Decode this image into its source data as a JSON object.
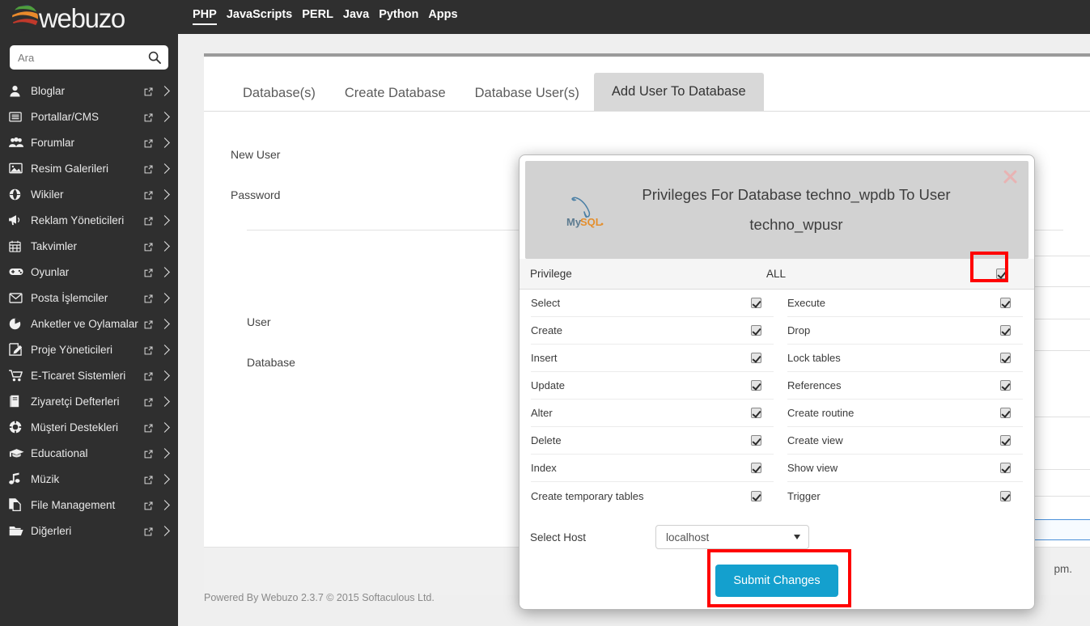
{
  "brand": {
    "name": "webuzo"
  },
  "topnav": {
    "items": [
      {
        "label": "PHP",
        "active": true
      },
      {
        "label": "JavaScripts",
        "active": false
      },
      {
        "label": "PERL",
        "active": false
      },
      {
        "label": "Java",
        "active": false
      },
      {
        "label": "Python",
        "active": false
      },
      {
        "label": "Apps",
        "active": false
      }
    ]
  },
  "search": {
    "placeholder": "Ara",
    "value": ""
  },
  "sidebar": {
    "items": [
      {
        "label": "Bloglar",
        "icon": "user-icon"
      },
      {
        "label": "Portallar/CMS",
        "icon": "list-icon"
      },
      {
        "label": "Forumlar",
        "icon": "users-icon"
      },
      {
        "label": "Resim Galerileri",
        "icon": "image-icon"
      },
      {
        "label": "Wikiler",
        "icon": "globe-icon"
      },
      {
        "label": "Reklam Yöneticileri",
        "icon": "megaphone-icon"
      },
      {
        "label": "Takvimler",
        "icon": "calendar-icon"
      },
      {
        "label": "Oyunlar",
        "icon": "gamepad-icon"
      },
      {
        "label": "Posta İşlemciler",
        "icon": "envelope-icon"
      },
      {
        "label": "Anketler ve Oylamalar",
        "icon": "pie-chart-icon"
      },
      {
        "label": "Proje Yöneticileri",
        "icon": "edit-icon"
      },
      {
        "label": "E-Ticaret Sistemleri",
        "icon": "cart-icon"
      },
      {
        "label": "Ziyaretçi Defterleri",
        "icon": "book-icon"
      },
      {
        "label": "Müşteri Destekleri",
        "icon": "lifebuoy-icon"
      },
      {
        "label": "Educational",
        "icon": "graduation-cap-icon"
      },
      {
        "label": "Müzik",
        "icon": "music-note-icon"
      },
      {
        "label": "File Management",
        "icon": "files-icon"
      },
      {
        "label": "Diğerleri",
        "icon": "folder-open-icon"
      }
    ]
  },
  "tabs": [
    {
      "label": "Database(s)",
      "active": false
    },
    {
      "label": "Create Database",
      "active": false
    },
    {
      "label": "Database User(s)",
      "active": false
    },
    {
      "label": "Add User To Database",
      "active": true
    }
  ],
  "form": {
    "labels": [
      "New User",
      "Password",
      "User",
      "Database"
    ]
  },
  "modal": {
    "title": "Privileges For Database techno_wpdb To User techno_wpusr",
    "logo_alt": "MySQL",
    "close_label": "×",
    "header": {
      "privilege_col": "Privilege",
      "all_col": "ALL",
      "all_checked": true
    },
    "privileges_left": [
      {
        "name": "Select",
        "checked": true
      },
      {
        "name": "Create",
        "checked": true
      },
      {
        "name": "Insert",
        "checked": true
      },
      {
        "name": "Update",
        "checked": true
      },
      {
        "name": "Alter",
        "checked": true
      },
      {
        "name": "Delete",
        "checked": true
      },
      {
        "name": "Index",
        "checked": true
      },
      {
        "name": "Create temporary tables",
        "checked": true
      }
    ],
    "privileges_right": [
      {
        "name": "Execute",
        "checked": true
      },
      {
        "name": "Drop",
        "checked": true
      },
      {
        "name": "Lock tables",
        "checked": true
      },
      {
        "name": "References",
        "checked": true
      },
      {
        "name": "Create routine",
        "checked": true
      },
      {
        "name": "Create view",
        "checked": true
      },
      {
        "name": "Show view",
        "checked": true
      },
      {
        "name": "Trigger",
        "checked": true
      }
    ],
    "host": {
      "label": "Select Host",
      "selected": "localhost",
      "options": [
        "localhost"
      ]
    },
    "submit_label": "Submit Changes"
  },
  "panel_footer": {
    "right_text": "pm."
  },
  "page_footer": {
    "text": "Powered By Webuzo 2.3.7 © 2015 Softaculous Ltd."
  },
  "colors": {
    "sidebar_bg": "#2f2f2f",
    "accent_button": "#14a0ce",
    "annotation": "#ff0000",
    "modal_head": "#d2d2d2",
    "active_tab": "#d8d8d8"
  }
}
